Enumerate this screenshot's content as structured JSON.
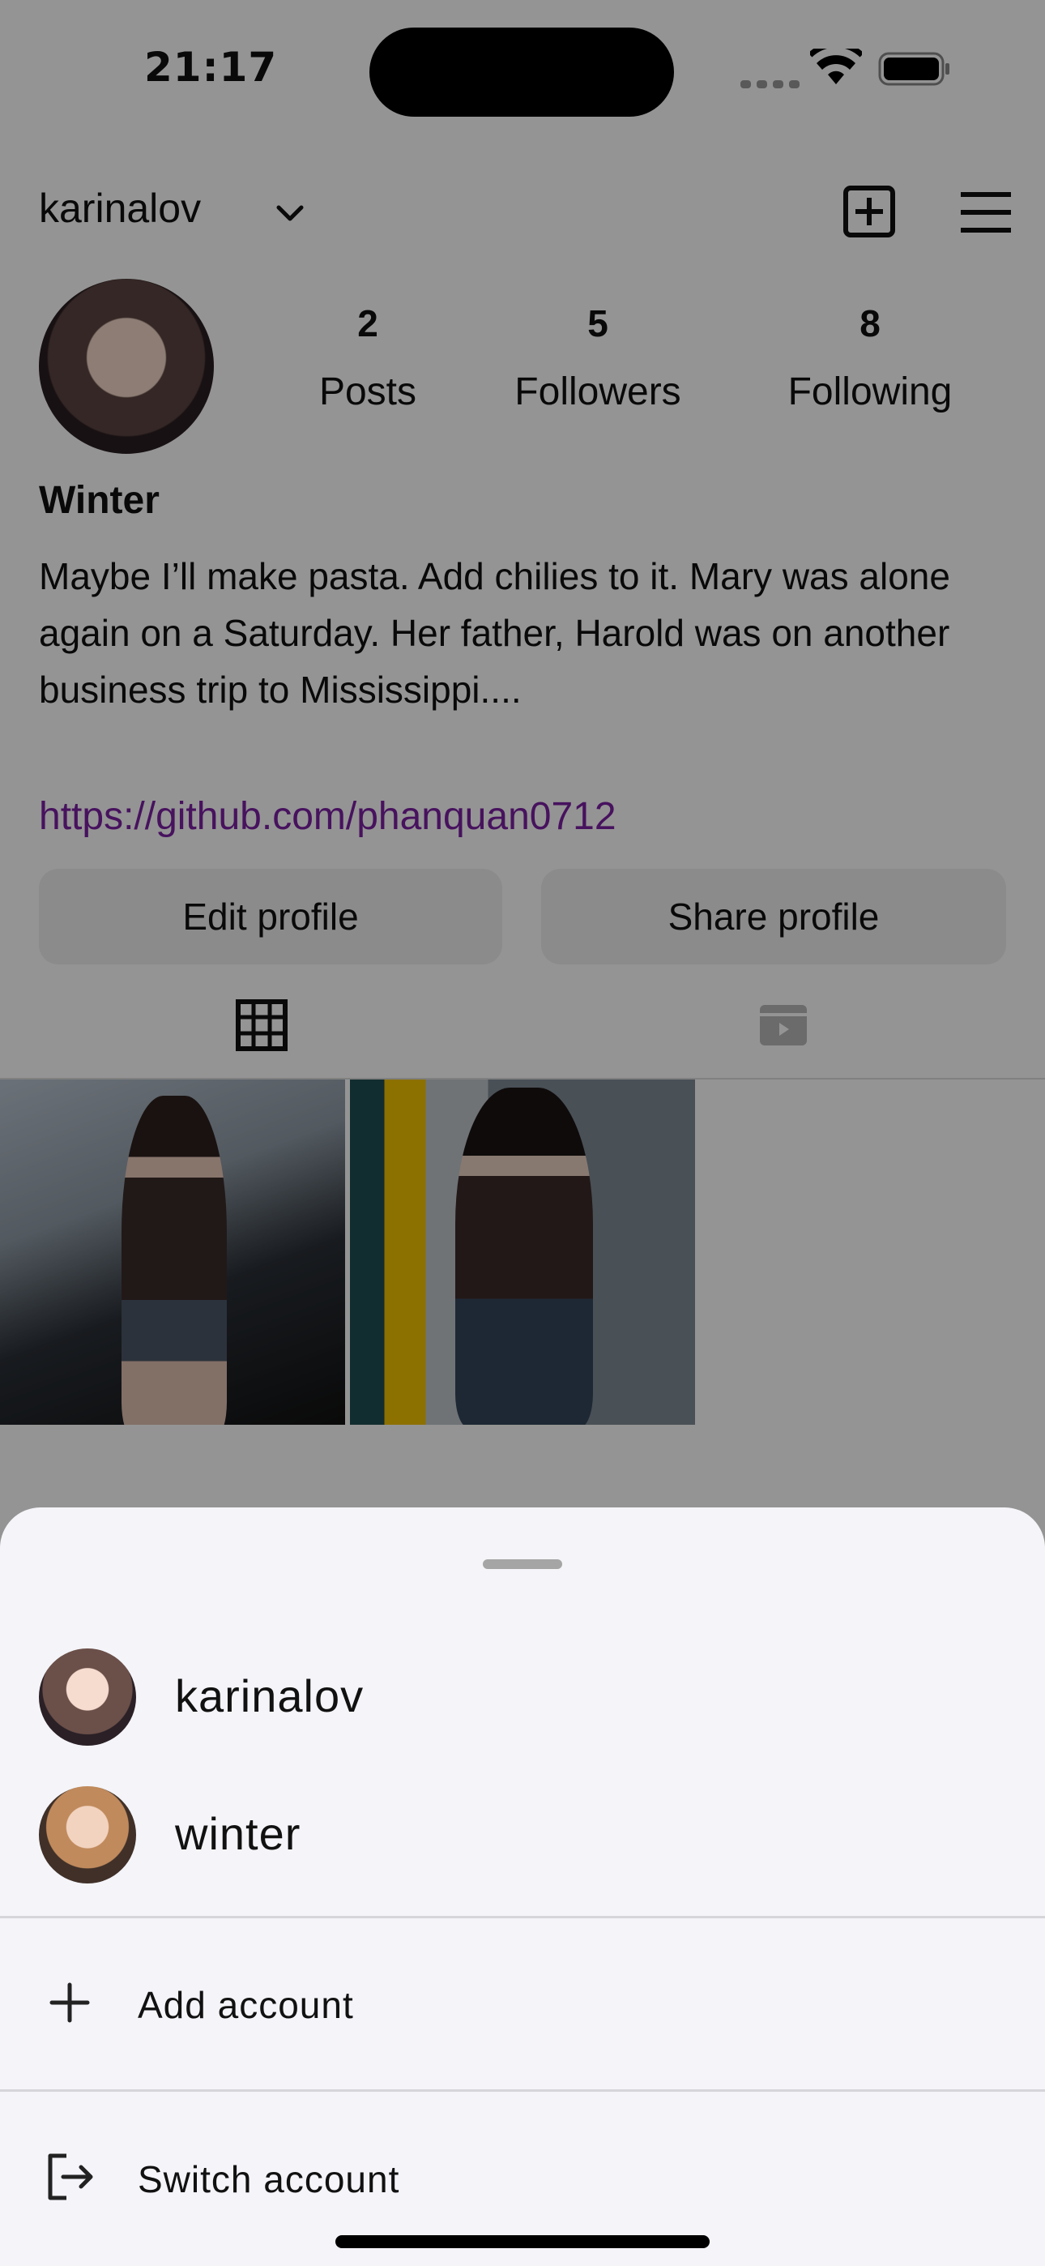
{
  "status": {
    "time": "21:17"
  },
  "profile": {
    "username": "karinalov",
    "stats": [
      {
        "count": "2",
        "label": "Posts"
      },
      {
        "count": "5",
        "label": "Followers"
      },
      {
        "count": "8",
        "label": "Following"
      }
    ],
    "display_name": "Winter",
    "bio": "Maybe I’ll make pasta. Add chilies to it. Mary was alone again on a Saturday. Her father, Harold was on another business trip to Mississippi....",
    "link": "https://github.com/phanquan0712",
    "buttons": {
      "edit": "Edit profile",
      "share": "Share profile"
    }
  },
  "tabs": {
    "grid_icon": "grid-icon",
    "reels_icon": "reels-icon"
  },
  "sheet": {
    "accounts": [
      {
        "name": "karinalov"
      },
      {
        "name": "winter"
      }
    ],
    "add_account": "Add account",
    "switch_account": "Switch account"
  },
  "colors": {
    "link": "#7b1fa2",
    "sheet_bg": "#f4f4f9"
  }
}
